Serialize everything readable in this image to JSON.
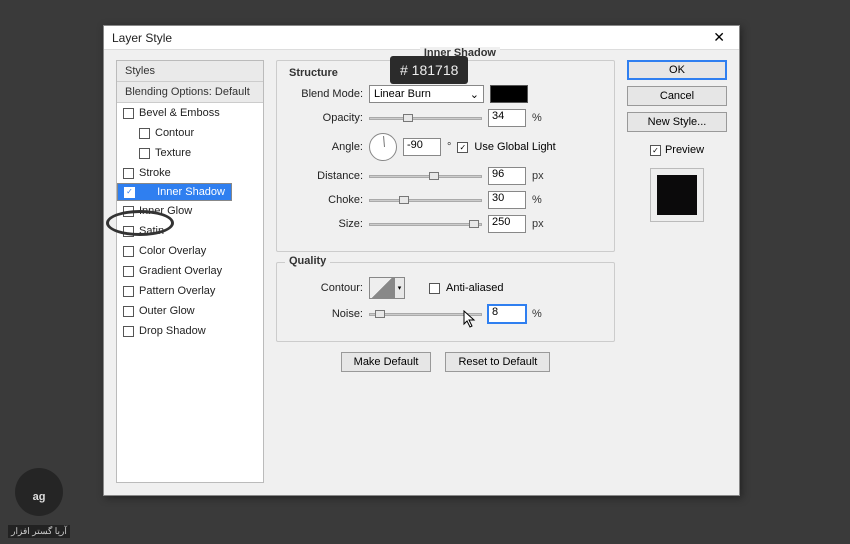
{
  "tooltip": "# 181718",
  "dialog": {
    "title": "Layer Style",
    "close": "✕"
  },
  "styles": {
    "header": "Styles",
    "blending": "Blending Options: Default",
    "items": [
      {
        "label": "Bevel & Emboss",
        "checked": false,
        "indent": false
      },
      {
        "label": "Contour",
        "checked": false,
        "indent": true
      },
      {
        "label": "Texture",
        "checked": false,
        "indent": true
      },
      {
        "label": "Stroke",
        "checked": false,
        "indent": false
      },
      {
        "label": "Inner Shadow",
        "checked": true,
        "indent": false,
        "selected": true
      },
      {
        "label": "Inner Glow",
        "checked": false,
        "indent": false
      },
      {
        "label": "Satin",
        "checked": false,
        "indent": false
      },
      {
        "label": "Color Overlay",
        "checked": false,
        "indent": false
      },
      {
        "label": "Gradient Overlay",
        "checked": false,
        "indent": false
      },
      {
        "label": "Pattern Overlay",
        "checked": false,
        "indent": false
      },
      {
        "label": "Outer Glow",
        "checked": false,
        "indent": false
      },
      {
        "label": "Drop Shadow",
        "checked": false,
        "indent": false
      }
    ]
  },
  "structure": {
    "panel_title": "Inner Shadow",
    "legend": "Structure",
    "blend_mode_label": "Blend Mode:",
    "blend_mode_value": "Linear Burn",
    "color": "#181718",
    "opacity_label": "Opacity:",
    "opacity_value": "34",
    "percent": "%",
    "angle_label": "Angle:",
    "angle_value": "-90",
    "degree": "°",
    "global_light_label": "Use Global Light",
    "global_light_checked": true,
    "distance_label": "Distance:",
    "distance_value": "96",
    "px": "px",
    "choke_label": "Choke:",
    "choke_value": "30",
    "size_label": "Size:",
    "size_value": "250"
  },
  "quality": {
    "legend": "Quality",
    "contour_label": "Contour:",
    "anti_aliased_label": "Anti-aliased",
    "anti_aliased_checked": false,
    "noise_label": "Noise:",
    "noise_value": "8"
  },
  "buttons": {
    "make_default": "Make Default",
    "reset_default": "Reset to Default",
    "ok": "OK",
    "cancel": "Cancel",
    "new_style": "New Style...",
    "preview": "Preview",
    "preview_checked": true
  },
  "logo_text": "آریا گستر افزار"
}
